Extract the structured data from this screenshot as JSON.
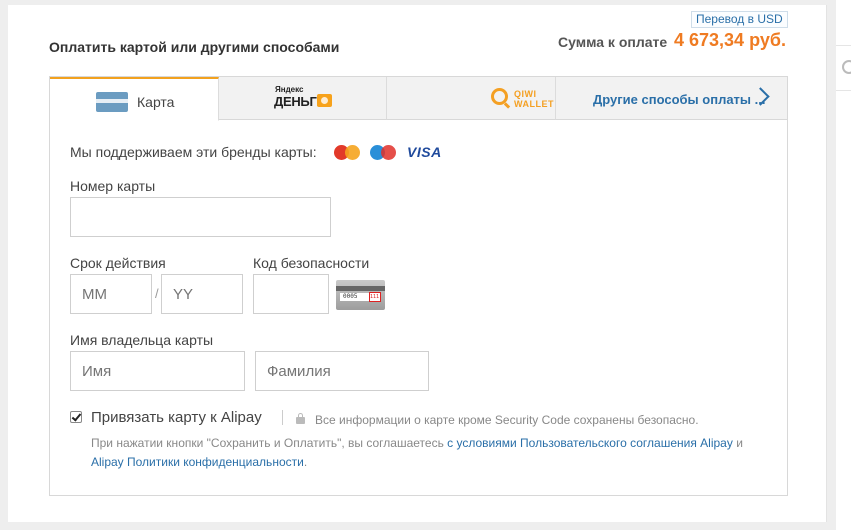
{
  "header": {
    "usd_link": "Перевод в USD",
    "title": "Оплатить картой или другими способами",
    "sum_label": "Сумма к оплате",
    "sum_value": "4 673,34 руб."
  },
  "tabs": {
    "card_label": "Карта",
    "yandex_small": "Яндекс",
    "yandex_big": "ДЕНЬГИ",
    "qiwi_line1": "QIWI",
    "qiwi_line2": "WALLET",
    "other_label": "Другие способы оплаты ..."
  },
  "form": {
    "brands_label": "Мы поддерживаем эти бренды карты:",
    "brand_visa": "VISA",
    "card_number_label": "Номер карты",
    "card_number_value": "",
    "expiry_label": "Срок действия",
    "month_placeholder": "MM",
    "slash": "/",
    "year_placeholder": "YY",
    "cvv_label": "Код безопасности",
    "cvv_hint_number": "0005",
    "cvv_hint_code": "111",
    "holder_label": "Имя владельца карты",
    "first_name_placeholder": "Имя",
    "last_name_placeholder": "Фамилия"
  },
  "bind": {
    "checked": true,
    "label": "Привязать карту к Alipay",
    "secure_note": "Все информации о карте кроме Security Code сохранены безопасно."
  },
  "terms": {
    "text_prefix": "При нажатии кнопки \"Сохранить и Оплатить\", вы соглашаетесь",
    "link1": "с условиями Пользовательского соглашения Alipay",
    "and": "и",
    "link2": "Alipay Политики конфиденциальности",
    "end": "."
  },
  "colors": {
    "accent_orange": "#ef7b22",
    "link_blue": "#2a6fa8",
    "active_tab_border": "#f2a11e"
  }
}
